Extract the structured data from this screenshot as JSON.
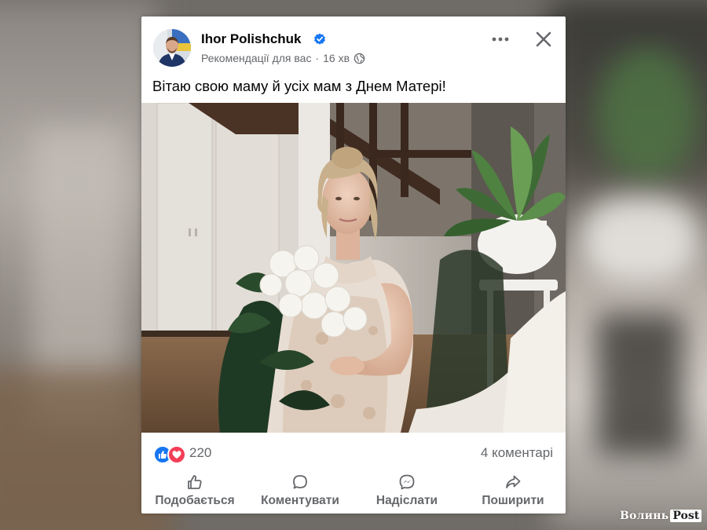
{
  "post": {
    "author": "Ihor Polishchuk",
    "recommended_label": "Рекомендації для вас",
    "separator": "·",
    "time_ago": "16 хв",
    "text": "Вітаю свою маму й усіх мам з Днем Матері!",
    "verified_icon": "verified-badge-icon",
    "privacy_icon": "globe-icon"
  },
  "stats": {
    "reactions_count": "220",
    "comments_count": "4 коментарі"
  },
  "actions": {
    "like": "Подобається",
    "comment": "Коментувати",
    "send": "Надіслати",
    "share": "Поширити"
  },
  "watermark": {
    "brand": "Волинь",
    "box": "Post"
  },
  "colors": {
    "facebook_blue": "#1877f2",
    "love_red": "#f33e58",
    "secondary_text": "#65676b"
  }
}
